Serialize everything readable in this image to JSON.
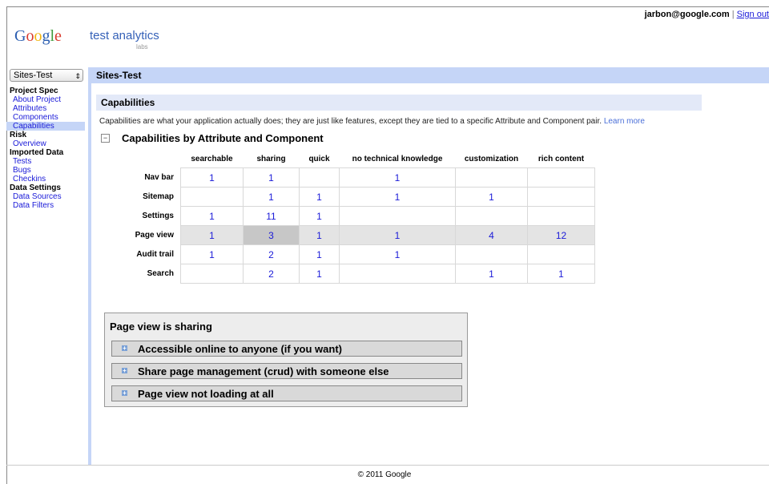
{
  "top": {
    "email": "jarbon@google.com",
    "separator": "|",
    "sign_out": "Sign out"
  },
  "logo": {
    "google": [
      "G",
      "o",
      "o",
      "g",
      "l",
      "e"
    ],
    "product": "test analytics",
    "labs": "labs"
  },
  "site_select": {
    "value": "Sites-Test",
    "arrow": "⇕"
  },
  "header": {
    "title": "Sites-Test"
  },
  "sidebar": {
    "groups": [
      {
        "head": "Project Spec",
        "items": [
          "About Project",
          "Attributes",
          "Components",
          "Capabilities"
        ]
      },
      {
        "head": "Risk",
        "items": [
          "Overview"
        ]
      },
      {
        "head": "Imported Data",
        "items": [
          "Tests",
          "Bugs",
          "Checkins"
        ]
      },
      {
        "head": "Data Settings",
        "items": [
          "Data Sources",
          "Data Filters"
        ]
      }
    ],
    "selected": "Capabilities"
  },
  "capabilities": {
    "title": "Capabilities",
    "description": "Capabilities are what your application actually does; they are just like features, except they are tied to a specific Attribute and Component pair.",
    "learn_more": "Learn more",
    "collapse_icon": "−",
    "table_title": "Capabilities by Attribute and Component"
  },
  "grid": {
    "columns": [
      "searchable",
      "sharing",
      "quick",
      "no technical knowledge",
      "customization",
      "rich content"
    ],
    "rows": [
      {
        "label": "Nav bar",
        "values": [
          "1",
          "1",
          "",
          "1",
          "",
          ""
        ]
      },
      {
        "label": "Sitemap",
        "values": [
          "",
          "1",
          "1",
          "1",
          "1",
          ""
        ]
      },
      {
        "label": "Settings",
        "values": [
          "1",
          "11",
          "1",
          "",
          "",
          ""
        ]
      },
      {
        "label": "Page view",
        "values": [
          "1",
          "3",
          "1",
          "1",
          "4",
          "12"
        ]
      },
      {
        "label": "Audit trail",
        "values": [
          "1",
          "2",
          "1",
          "1",
          "",
          ""
        ]
      },
      {
        "label": "Search",
        "values": [
          "",
          "2",
          "1",
          "",
          "1",
          "1"
        ]
      }
    ],
    "highlight_row": "Page view",
    "selected_cell": {
      "row": "Page view",
      "column": "sharing"
    }
  },
  "panel": {
    "title": "Page view is sharing",
    "items": [
      "Accessible online to anyone (if you want)",
      "Share page management (crud) with someone else",
      "Page view not loading at all"
    ],
    "expand_icon": "+"
  },
  "footer": {
    "text": "© 2011 Google"
  }
}
